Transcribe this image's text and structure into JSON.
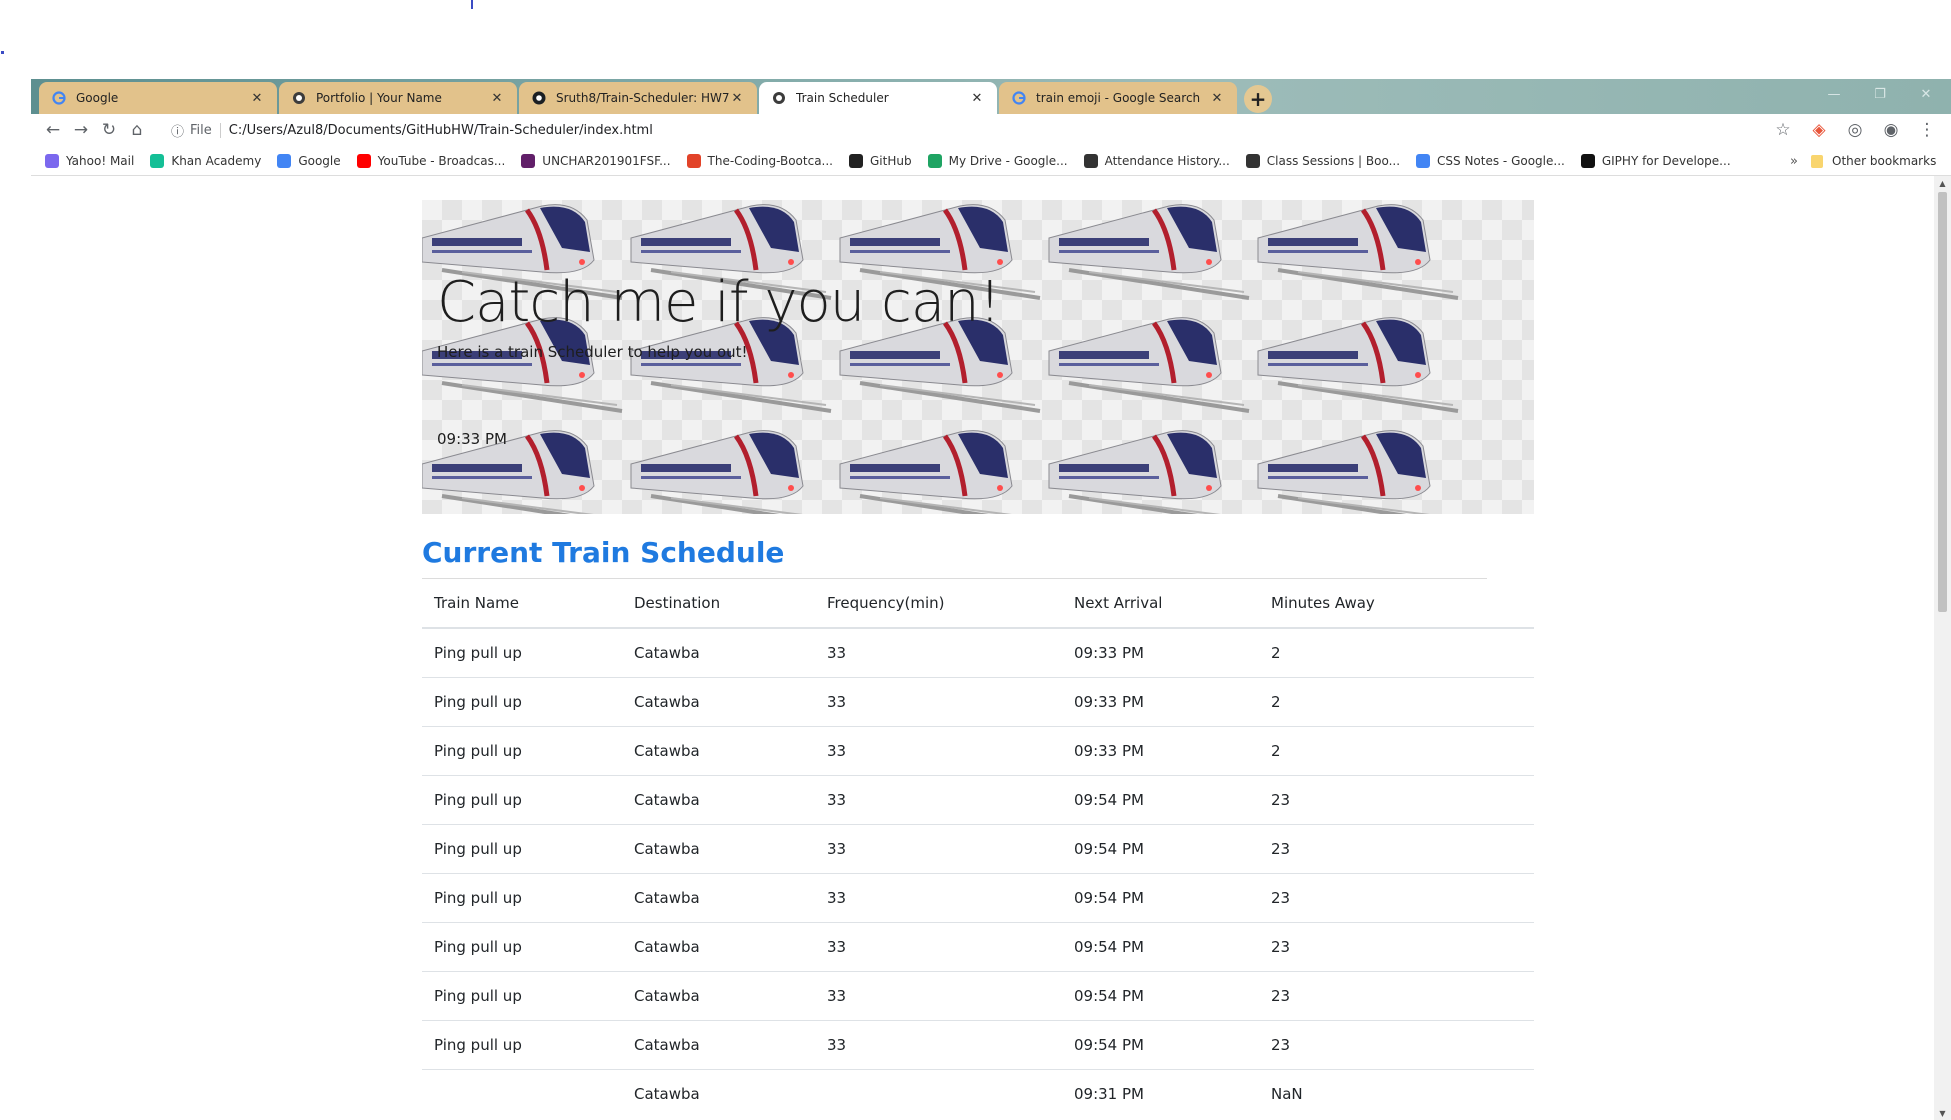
{
  "browser": {
    "tabs": [
      {
        "title": "Google",
        "icon": "google-icon",
        "active": false
      },
      {
        "title": "Portfolio | Your Name",
        "icon": "globe-icon",
        "active": false
      },
      {
        "title": "Sruth8/Train-Scheduler: HW7",
        "icon": "github-icon",
        "active": false
      },
      {
        "title": "Train Scheduler",
        "icon": "globe-icon",
        "active": true
      },
      {
        "title": "train emoji - Google Search",
        "icon": "google-icon",
        "active": false
      }
    ],
    "address": {
      "scheme": "File",
      "url": "C:/Users/Azul8/Documents/GitHubHW/Train-Scheduler/index.html"
    },
    "bookmarks": [
      {
        "label": "Yahoo! Mail",
        "icon": "mail-icon",
        "color": "#7b68ee"
      },
      {
        "label": "Khan Academy",
        "icon": "khan-academy-icon",
        "color": "#14bf96"
      },
      {
        "label": "Google",
        "icon": "google-icon",
        "color": "#4285f4"
      },
      {
        "label": "YouTube - Broadcas...",
        "icon": "youtube-icon",
        "color": "#ff0000"
      },
      {
        "label": "UNCHAR201901FSF...",
        "icon": "slack-icon",
        "color": "#611f69"
      },
      {
        "label": "The-Coding-Bootca...",
        "icon": "gitlab-icon",
        "color": "#e24329"
      },
      {
        "label": "GitHub",
        "icon": "github-icon",
        "color": "#222222"
      },
      {
        "label": "My Drive - Google...",
        "icon": "drive-icon",
        "color": "#1fa463"
      },
      {
        "label": "Attendance History...",
        "icon": "globe-icon",
        "color": "#333333"
      },
      {
        "label": "Class Sessions | Boo...",
        "icon": "globe-icon",
        "color": "#333333"
      },
      {
        "label": "CSS Notes - Google...",
        "icon": "docs-icon",
        "color": "#4285f4"
      },
      {
        "label": "GIPHY for Develope...",
        "icon": "giphy-icon",
        "color": "#111111"
      }
    ],
    "more_bookmarks": "»",
    "other_bookmarks": "Other bookmarks"
  },
  "page": {
    "title": "Catch me if you can!",
    "lead": "Here is a train Scheduler to help you out!",
    "clock": "09:33 PM",
    "schedule_heading": "Current Train Schedule",
    "columns": [
      "Train Name",
      "Destination",
      "Frequency(min)",
      "Next Arrival",
      "Minutes Away"
    ],
    "rows": [
      [
        "Ping pull up",
        "Catawba",
        "33",
        "09:33 PM",
        "2"
      ],
      [
        "Ping pull up",
        "Catawba",
        "33",
        "09:33 PM",
        "2"
      ],
      [
        "Ping pull up",
        "Catawba",
        "33",
        "09:33 PM",
        "2"
      ],
      [
        "Ping pull up",
        "Catawba",
        "33",
        "09:54 PM",
        "23"
      ],
      [
        "Ping pull up",
        "Catawba",
        "33",
        "09:54 PM",
        "23"
      ],
      [
        "Ping pull up",
        "Catawba",
        "33",
        "09:54 PM",
        "23"
      ],
      [
        "Ping pull up",
        "Catawba",
        "33",
        "09:54 PM",
        "23"
      ],
      [
        "Ping pull up",
        "Catawba",
        "33",
        "09:54 PM",
        "23"
      ],
      [
        "Ping pull up",
        "Catawba",
        "33",
        "09:54 PM",
        "23"
      ],
      [
        "",
        "Catawba",
        "",
        "09:31 PM",
        "NaN"
      ]
    ]
  },
  "colors": {
    "heading": "#1f7ae0",
    "tab_inactive": "#e2c28b",
    "tab_active": "#ffffff"
  }
}
